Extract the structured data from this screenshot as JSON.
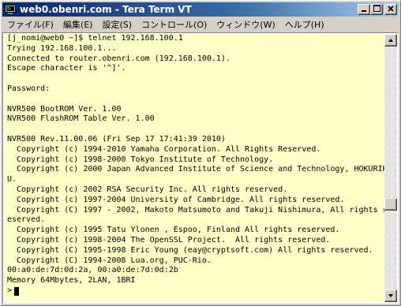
{
  "window": {
    "title": "web0.obenri.com - Tera Term VT",
    "icon": "tera-term-icon",
    "buttons": {
      "minimize": "minimize-icon",
      "maximize": "maximize-icon",
      "close": "close-icon"
    }
  },
  "menu": [
    {
      "label": "ファイル(F)"
    },
    {
      "label": "編集(E)"
    },
    {
      "label": "設定(S)"
    },
    {
      "label": "コントロール(O)"
    },
    {
      "label": "ウィンドウ(W)"
    },
    {
      "label": "ヘルプ(H)"
    }
  ],
  "terminal": {
    "background": "#ffffc8",
    "lines": [
      "[j_nomi@web0 ~]$ telnet 192.168.100.1",
      "Trying 192.168.100.1...",
      "Connected to router.obenri.com (192.168.100.1).",
      "Escape character is '^]'.",
      "",
      "Password:",
      "",
      "NVR500 BootROM Ver. 1.00",
      "NVR500 FlashROM Table Ver. 1.00",
      "",
      "NVR500 Rev.11.00.06 (Fri Sep 17 17:41:39 2010)",
      "  Copyright (c) 1994-2010 Yamaha Corporation. All Rights Reserved.",
      "  Copyright (c) 1998-2000 Tokyo Institute of Technology.",
      "  Copyright (c) 2000 Japan Advanced Institute of Science and Technology, HOKURIK",
      "U.",
      "  Copyright (c) 2002 RSA Security Inc. All rights reserved.",
      "  Copyright (c) 1997-2004 University of Cambridge. All rights reserved.",
      "  Copyright (C) 1997 - 2002, Makoto Matsumoto and Takuji Nishimura, All rights r",
      "eserved.",
      "  Copyright (c) 1995 Tatu Ylonen , Espoo, Finland All rights reserved.",
      "  Copyright (c) 1998-2004 The OpenSSL Project.  All rights reserved.",
      "  Copyright (C) 1995-1998 Eric Young (eay@cryptsoft.com) All rights reserved.",
      "  Copyright (C) 1994-2008 Lua.org, PUC-Rio.",
      "00:a0:de:7d:0d:2a, 00:a0:de:7d:0d:2b",
      "Memory 64Mbytes, 2LAN, 1BRI",
      ">"
    ]
  }
}
